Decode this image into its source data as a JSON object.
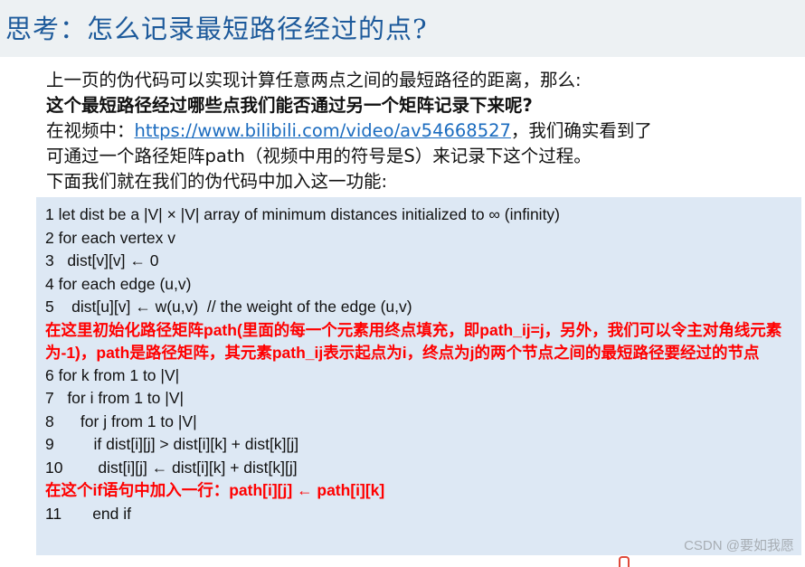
{
  "title": "思考：怎么记录最短路径经过的点?",
  "intro": {
    "line1": "上一页的伪代码可以实现计算任意两点之间的最短路径的距离，那么:",
    "line2_bold": "这个最短路径经过哪些点我们能否通过另一个矩阵记录下来呢?",
    "line3_prefix": "在视频中：",
    "line3_link": "https://www.bilibili.com/video/av54668527",
    "line3_suffix": "，我们确实看到了",
    "line4": "可通过一个路径矩阵path（视频中用的符号是S）来记录下这个过程。",
    "line5": "下面我们就在我们的伪代码中加入这一功能:"
  },
  "code": {
    "lines": [
      "1 let dist be a |V| × |V| array of minimum distances initialized to ∞ (infinity)",
      "2 for each vertex v",
      "3   dist[v][v] ← 0",
      "4 for each edge (u,v)",
      "5    dist[u][v] ← w(u,v)  // the weight of the edge (u,v)"
    ],
    "note1": "在这里初始化路径矩阵path(里面的每一个元素用终点填充，即path_ij=j，另外，我们可以令主对角线元素为-1)，path是路径矩阵，其元素path_ij表示起点为i，终点为j的两个节点之间的最短路径要经过的节点",
    "lines2": [
      "6 for k from 1 to |V|",
      "7   for i from 1 to |V|",
      "8      for j from 1 to |V|",
      "9         if dist[i][j] > dist[i][k] + dist[k][j]",
      "10        dist[i][j] ← dist[i][k] + dist[k][j]"
    ],
    "note2": "在这个if语句中加入一行：path[i][j] ← path[i][k]",
    "line11": "11       end if"
  },
  "watermark": "CSDN @要如我愿",
  "colors": {
    "title": "#1d5a9b",
    "link": "#1a6bbf",
    "note": "#ff0000",
    "code_bg": "#dde8f4",
    "title_bg": "#edf1f3"
  }
}
